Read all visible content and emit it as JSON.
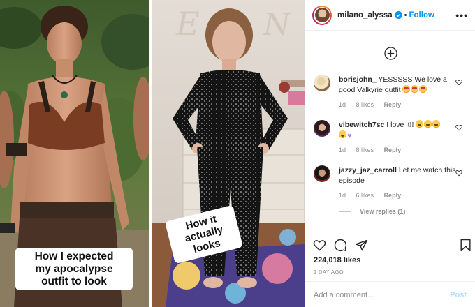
{
  "media": {
    "left_caption_lines": [
      "How I expected",
      "my apocalypse",
      "outfit to look"
    ],
    "right_caption_lines": [
      "How it",
      "actually looks"
    ]
  },
  "header": {
    "username": "milano_alyssa",
    "separator": "•",
    "follow_label": "Follow",
    "more_glyph": "•••"
  },
  "comments": [
    {
      "user": "borisjohn_",
      "text": "YESSSSS We love a good Valkyrie outfit",
      "emojis": [
        "heart-eyes",
        "heart-eyes",
        "heart-eyes"
      ],
      "age": "1d",
      "likes": "8 likes",
      "reply": "Reply"
    },
    {
      "user": "vibewitch7sc",
      "text": "I love it!!",
      "emojis": [
        "laugh",
        "laugh",
        "laugh",
        "laugh",
        "purple-heart"
      ],
      "age": "1d",
      "likes": "8 likes",
      "reply": "Reply"
    },
    {
      "user": "jazzy_jaz_carroll",
      "text": "Let me watch this episode",
      "emojis": [],
      "age": "1d",
      "likes": "6 likes",
      "reply": "Reply"
    }
  ],
  "view_replies_label": "View replies (1)",
  "footer": {
    "likes": "224,018 likes",
    "date": "1 DAY AGO",
    "comment_placeholder": "Add a comment...",
    "post_label": "Post"
  },
  "colors": {
    "accent": "#0095f6",
    "post_disabled": "#b2dffc",
    "muted": "#8e8e8e"
  },
  "icons": [
    "verified-badge-icon",
    "plus-circle-icon",
    "heart-icon",
    "comment-icon",
    "share-icon",
    "bookmark-icon",
    "more-icon"
  ]
}
